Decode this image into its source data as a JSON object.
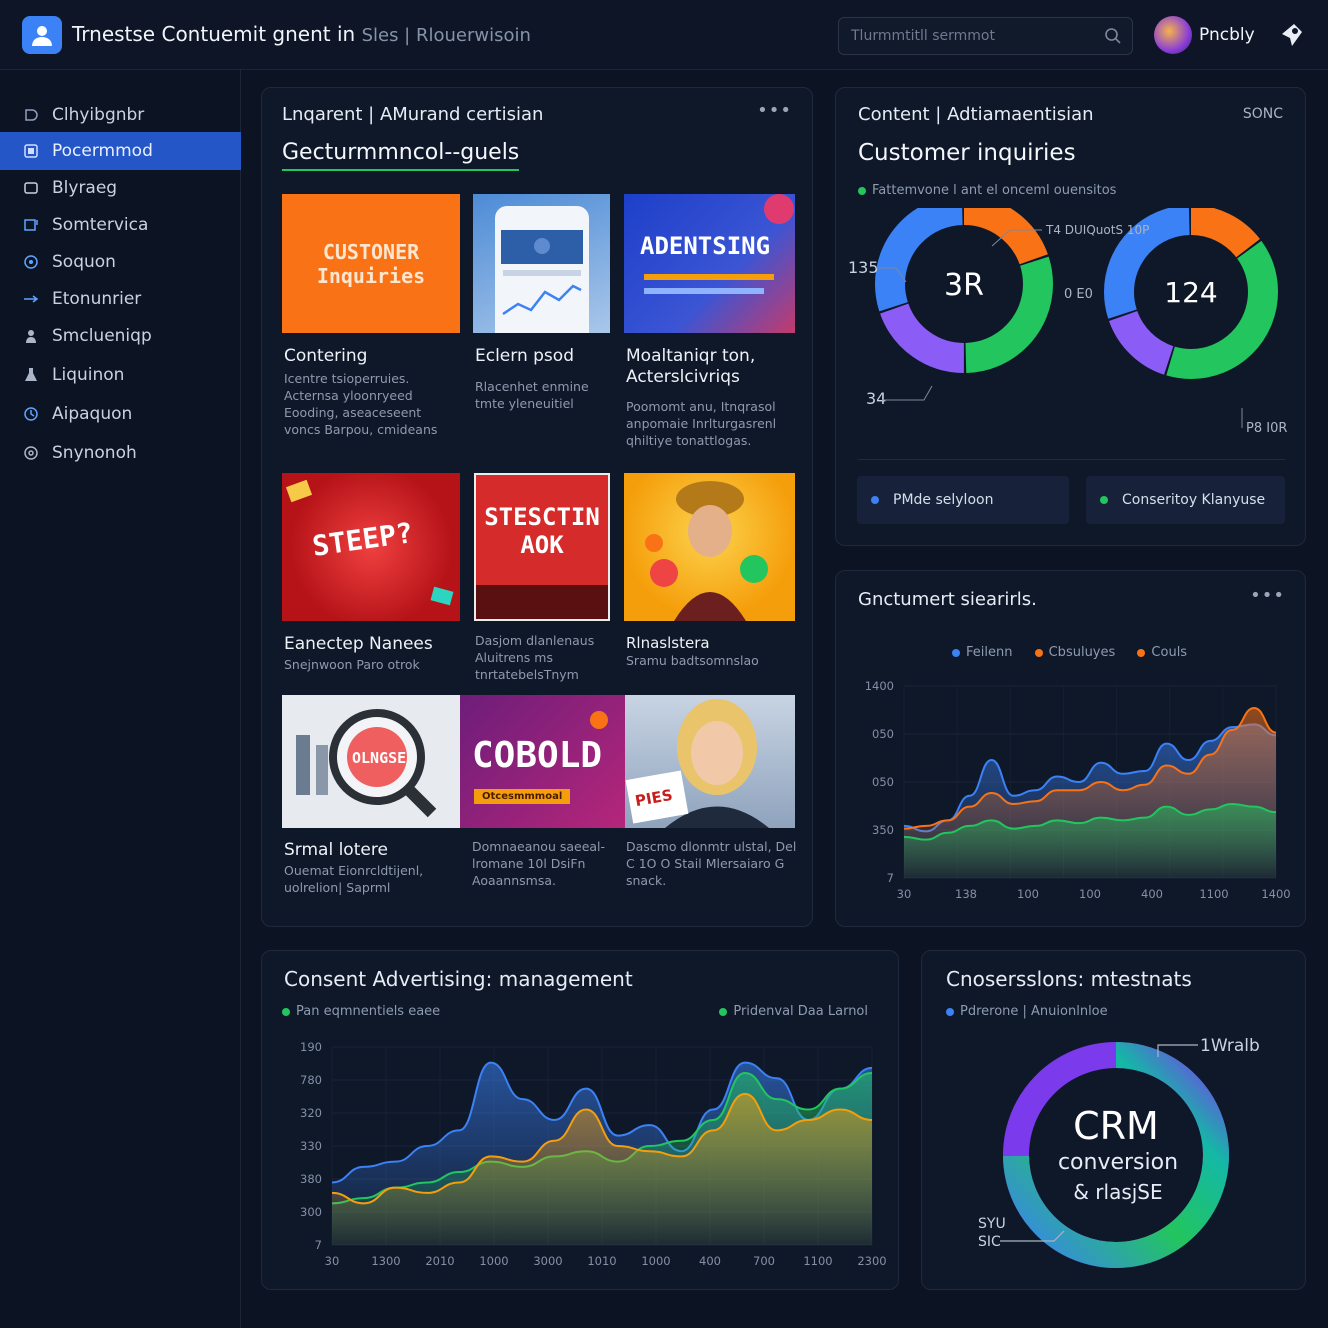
{
  "header": {
    "title": "Trnestse Contuemit gnent in",
    "title_sub": "Sles | Rlouerwisoin",
    "search_placeholder": "Tlurmmtitll sermmot",
    "user_name": "Pncbly"
  },
  "sidebar": {
    "items": [
      {
        "label": "Clhyibgnbr",
        "icon": "dashboard-icon"
      },
      {
        "label": "Pocermmod",
        "icon": "content-icon",
        "active": true
      },
      {
        "label": "Blyraeg",
        "icon": "square-icon"
      },
      {
        "label": "Somtervica",
        "icon": "service-icon"
      },
      {
        "label": "Soquon",
        "icon": "target-icon"
      },
      {
        "label": "Etonunrier",
        "icon": "arrow-icon"
      },
      {
        "label": "Smclueniqp",
        "icon": "person-icon"
      },
      {
        "label": "Liquinon",
        "icon": "flask-icon"
      },
      {
        "label": "Aipaquon",
        "icon": "clock-icon"
      },
      {
        "label": "Snynonoh",
        "icon": "settings-icon"
      }
    ]
  },
  "gallery": {
    "title": "Lnqarent | AMurand certisian",
    "subtitle": "Gecturmmncol--guels",
    "tiles": [
      {
        "title": "Contering",
        "desc": "Icentre tsioperruies. Acternsa yloonryeed Eooding, aseaceseent voncs Barpou, cmideans",
        "img_text": "CUSTONER Inquiries"
      },
      {
        "title": "Eclern psod",
        "desc": "Rlacenhet enmine tmte yleneuitiel",
        "img_text": ""
      },
      {
        "title": "Moaltaniqr ton, Acterslcivriqs",
        "desc": "Poomomt anu, Itnqrasol anpomaie Inrlturgasrenl qhiltiye tonattlogas.",
        "img_text": "ADENTSING"
      },
      {
        "title": "Eanectep Nanees",
        "desc": "Snejnwoon Paro otrok",
        "img_text": "STEEP?"
      },
      {
        "title": "",
        "desc": "Dasjom dlanlenaus Aluitrens ms tnrtatebelsTnym",
        "img_text": "STESCTIN AOK"
      },
      {
        "title": "Rlnaslstera",
        "desc": "Sramu badtsomnslao",
        "img_text": ""
      },
      {
        "title": "Srmal lotere",
        "desc": "Ouemat Eionrcldtijenl, uolrelion| Saprml",
        "img_text": "OLNGSE"
      },
      {
        "title": "",
        "desc": "Domnaeanou saeeal- lromane 10l DsiFn Aoaannsmsa.",
        "img_text": "COBOLD",
        "img_badge": "Otcesmmmoal"
      },
      {
        "title": "",
        "desc": "Dascmo dlonmtr ulstal, Del C 1O O Stail Mlersaiaro G snack.",
        "img_text": "PIES"
      }
    ]
  },
  "inquiries": {
    "title": "Content | Adtiamaentisian",
    "badge": "SONC",
    "subtitle": "Customer inquiries",
    "legend": "Fattemvone l ant el onceml ouensitos",
    "donut_left": {
      "center": "3R",
      "label_top": "135",
      "label_bottom": "34",
      "segments": [
        {
          "color": "#f97316",
          "value": 20
        },
        {
          "color": "#22c55e",
          "value": 30
        },
        {
          "color": "#8b5cf6",
          "value": 20
        },
        {
          "color": "#3b82f6",
          "value": 30
        }
      ]
    },
    "donut_right": {
      "center": "124",
      "label_top": "T4 DUIQuotS 10P",
      "label_left": "0 E0",
      "label_bottom": "P8 I0R",
      "segments": [
        {
          "color": "#f97316",
          "value": 15
        },
        {
          "color": "#22c55e",
          "value": 40
        },
        {
          "color": "#8b5cf6",
          "value": 15
        },
        {
          "color": "#3b82f6",
          "value": 30
        }
      ]
    },
    "pill_left": "PMde selyloon",
    "pill_right": "Conseritoy Klanyuse",
    "pill_left_color": "#3b82f6",
    "pill_right_color": "#22c55e"
  },
  "trend": {
    "title": "Gnctumert siearirls.",
    "legend": [
      {
        "name": "Feilenn",
        "color": "#3b82f6"
      },
      {
        "name": "Cbsuluyes",
        "color": "#f97316"
      },
      {
        "name": "Couls",
        "color": "#f97316"
      }
    ]
  },
  "advertising": {
    "title": "Consent Advertising: management",
    "legend_left": "Pan eqmnentiels eaee",
    "legend_right": "Pridenval Daa Larnol"
  },
  "conversions": {
    "title": "Cnosersslons: mtestnats",
    "legend": "Pdrerone | Anuionlnloe",
    "center_line1": "CRM",
    "center_line2": "conversion",
    "center_line3": "& rlasjSE",
    "label_top": "1Wralb",
    "label_bottom_a": "SYU",
    "label_bottom_b": "SIC"
  },
  "chart_data": [
    {
      "type": "area",
      "title": "Gnctumert siearirls.",
      "categories": [
        "30",
        "138",
        "100",
        "100",
        "400",
        "1100",
        "1400"
      ],
      "y_ticks": [
        "7",
        "350",
        "050",
        "050",
        "1400"
      ],
      "ylim": [
        0,
        1400
      ],
      "series": [
        {
          "name": "Feilenn",
          "color": "#3b82f6",
          "values": [
            380,
            340,
            420,
            600,
            860,
            600,
            640,
            740,
            700,
            840,
            760,
            780,
            980,
            860,
            1000,
            1100,
            1120,
            1040
          ]
        },
        {
          "name": "Cbsuluyes",
          "color": "#f97316",
          "values": [
            360,
            380,
            420,
            520,
            620,
            540,
            560,
            640,
            640,
            700,
            640,
            680,
            820,
            760,
            900,
            1080,
            1240,
            1060
          ]
        },
        {
          "name": "Couls",
          "color": "#22c55e",
          "values": [
            300,
            280,
            330,
            380,
            420,
            360,
            380,
            420,
            400,
            440,
            420,
            440,
            520,
            460,
            500,
            540,
            520,
            480
          ]
        }
      ]
    },
    {
      "type": "area",
      "title": "Consent Advertising: management",
      "categories": [
        "30",
        "1300",
        "2010",
        "1000",
        "3000",
        "1010",
        "1000",
        "400",
        "700",
        "1100",
        "2300"
      ],
      "y_ticks": [
        "7",
        "300",
        "380",
        "330",
        "320",
        "780",
        "190"
      ],
      "ylim": [
        0,
        190
      ],
      "series": [
        {
          "name": "Pan eqmnentiels eaee",
          "color": "#3b82f6",
          "values": [
            60,
            75,
            80,
            95,
            110,
            175,
            140,
            120,
            150,
            105,
            115,
            90,
            130,
            175,
            160,
            120,
            150,
            170
          ]
        },
        {
          "name": "Pridenval Daa Larnol",
          "color": "#22c55e",
          "values": [
            40,
            45,
            55,
            60,
            70,
            80,
            75,
            85,
            90,
            80,
            95,
            100,
            120,
            165,
            140,
            130,
            150,
            165
          ]
        },
        {
          "name": "",
          "color": "#f59e0b",
          "values": [
            50,
            40,
            55,
            50,
            60,
            85,
            80,
            100,
            130,
            95,
            90,
            85,
            110,
            145,
            110,
            120,
            130,
            120
          ]
        }
      ]
    }
  ]
}
